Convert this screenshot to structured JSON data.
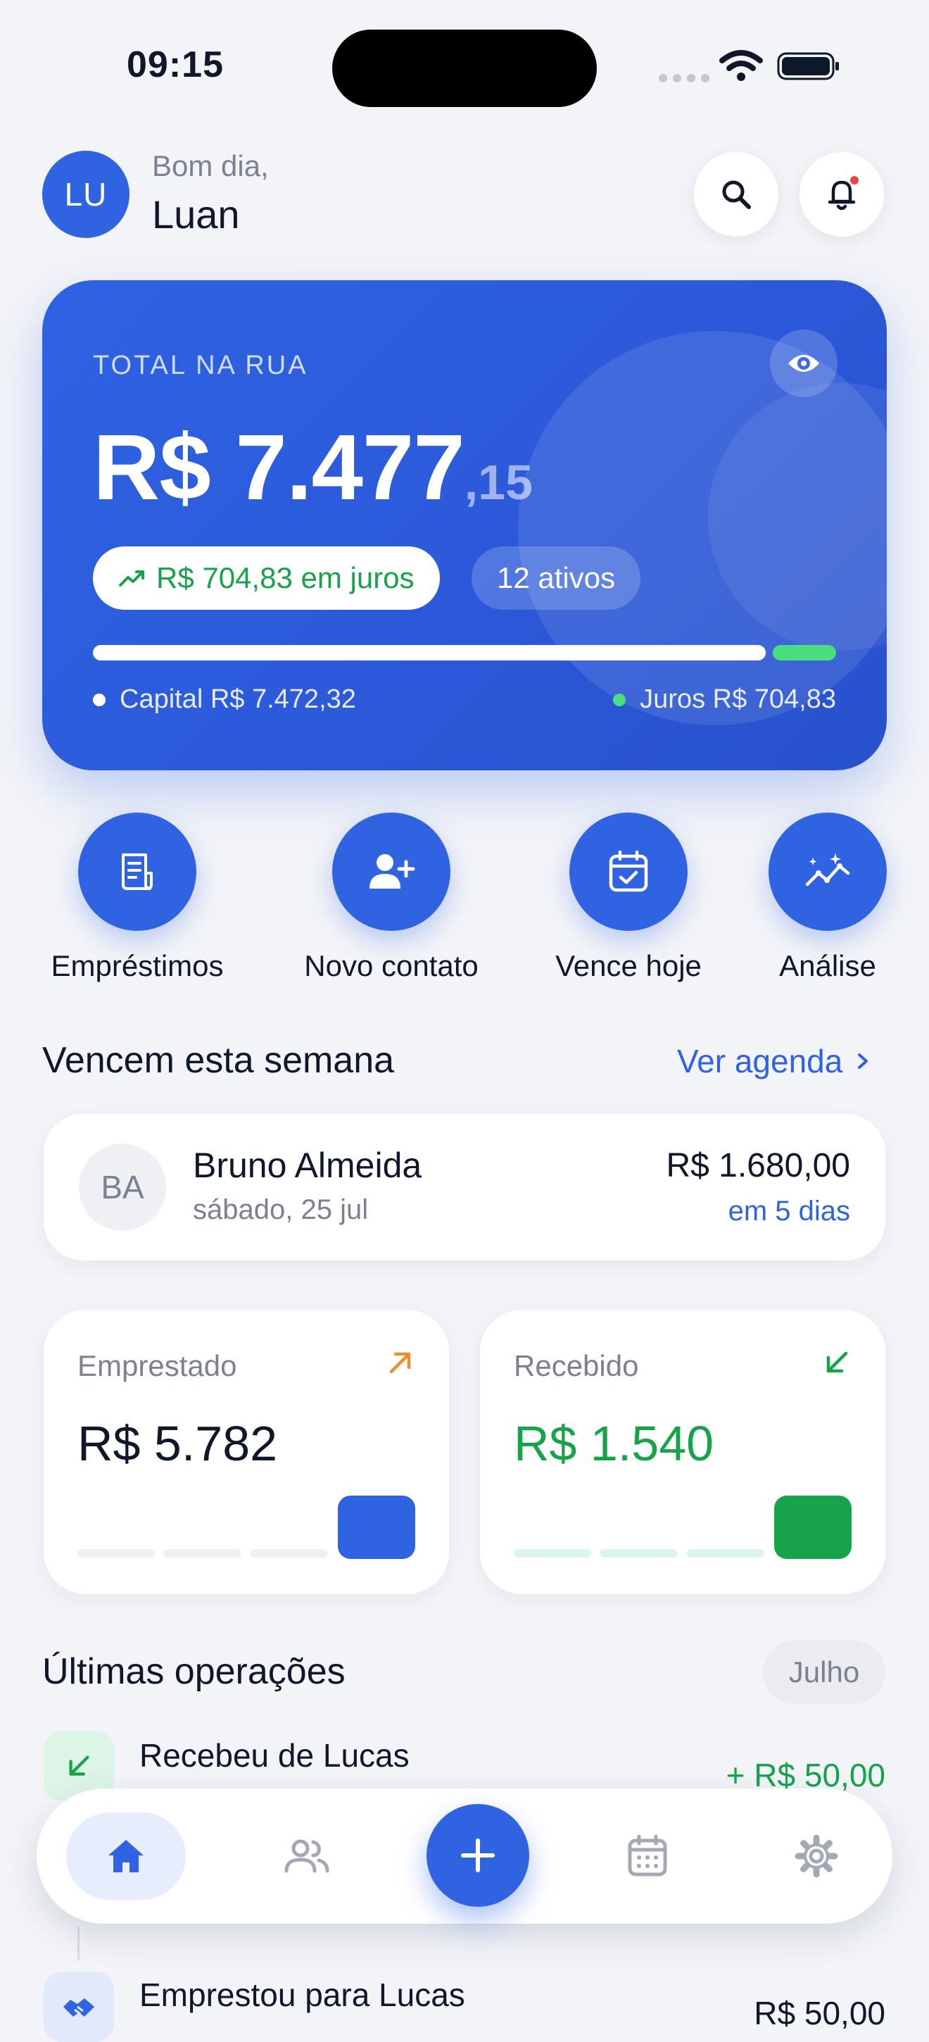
{
  "status_bar": {
    "time": "09:15"
  },
  "header": {
    "avatar_initials": "LU",
    "greeting": "Bom dia,",
    "user_name": "Luan"
  },
  "hero": {
    "label": "TOTAL NA RUA",
    "amount_int": "R$ 7.477",
    "amount_cents": ",15",
    "interest_pill": "R$ 704,83 em juros",
    "active_pill": "12 ativos",
    "capital_legend": "Capital R$ 7.472,32",
    "interest_legend": "Juros R$ 704,83",
    "capital_fraction": 0.914,
    "interest_fraction": 0.086
  },
  "actions": [
    {
      "label": "Empréstimos",
      "icon": "receipt-icon"
    },
    {
      "label": "Novo contato",
      "icon": "user-plus-icon"
    },
    {
      "label": "Vence hoje",
      "icon": "calendar-check-icon"
    },
    {
      "label": "Análise",
      "icon": "analytics-icon"
    }
  ],
  "due_week": {
    "title": "Vencem esta semana",
    "link": "Ver agenda",
    "item": {
      "initials": "BA",
      "name": "Bruno Almeida",
      "date": "sábado, 25 jul",
      "amount": "R$ 1.680,00",
      "due_in": "em 5 dias"
    }
  },
  "stats": {
    "lent": {
      "label": "Emprestado",
      "value": "R$ 5.782",
      "color": "#2F63E1"
    },
    "received": {
      "label": "Recebido",
      "value": "R$ 1.540",
      "color": "#16A34A"
    }
  },
  "operations": {
    "title": "Últimas operações",
    "month": "Julho",
    "items": [
      {
        "title": "Recebeu de Lucas",
        "amount": "+ R$ 50,00",
        "icon": "arrow-down-left-icon"
      },
      {
        "title": "Emprestou para Lucas",
        "amount": "R$ 50,00",
        "icon": "handshake-icon"
      }
    ]
  },
  "colors": {
    "primary": "#2F63E1",
    "success": "#16A34A",
    "accent_orange": "#E8922F",
    "background": "#F3F4F8"
  }
}
